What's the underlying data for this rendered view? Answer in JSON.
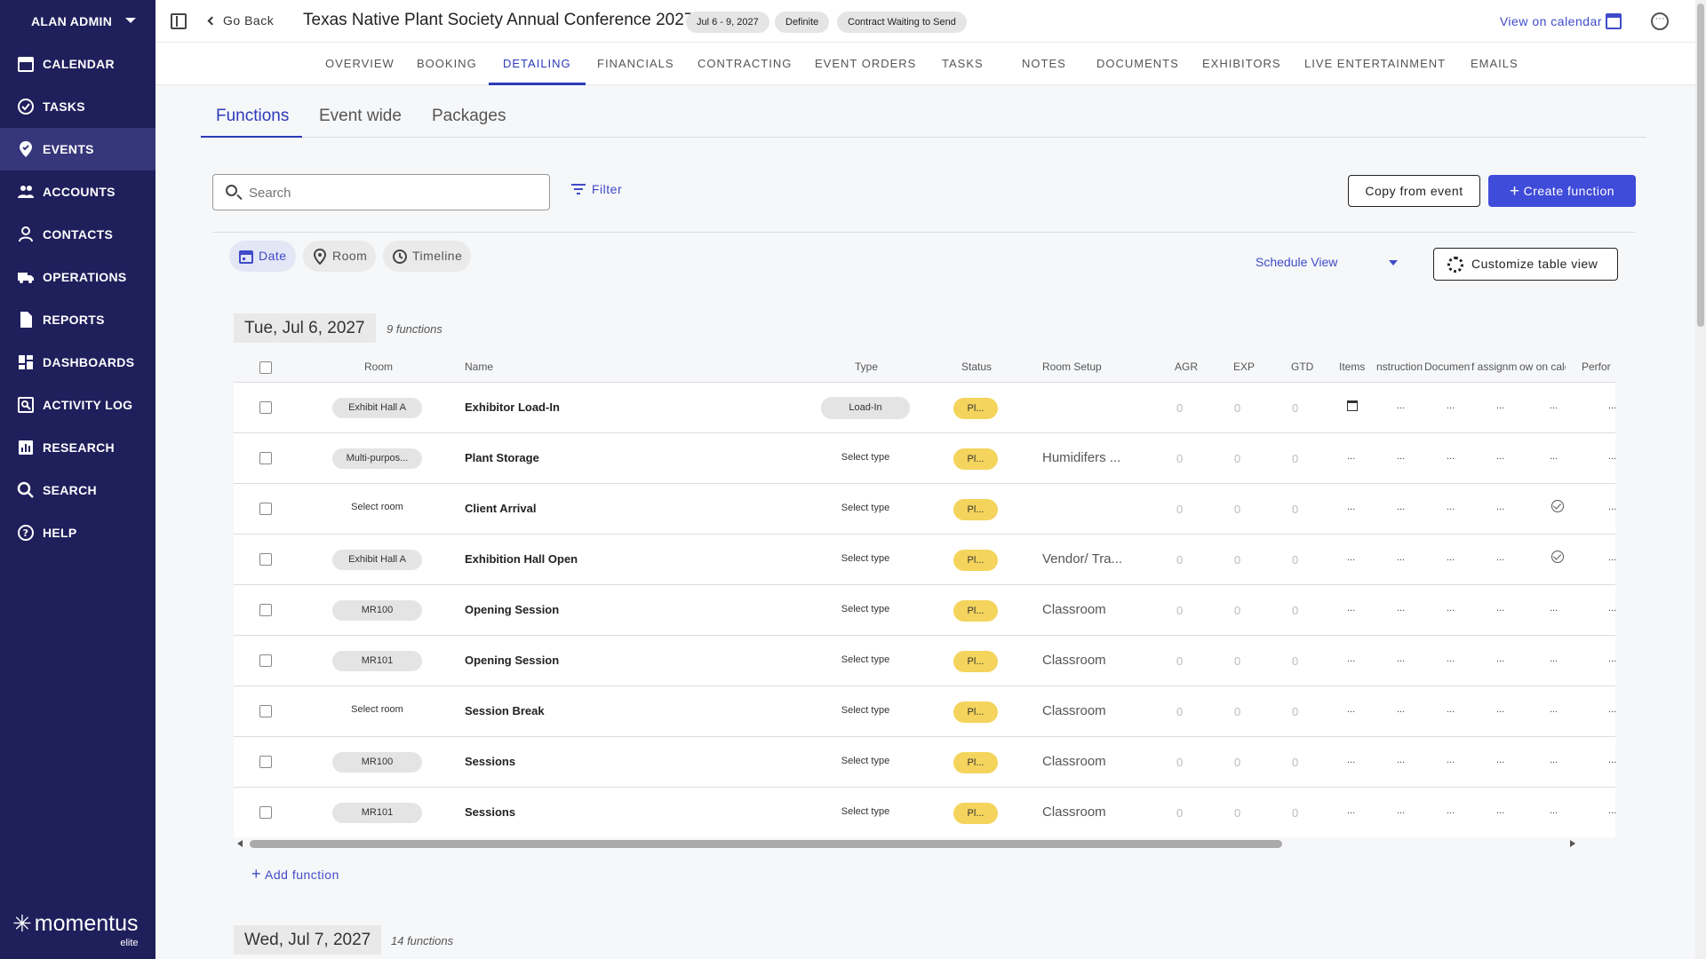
{
  "sidebar": {
    "user": "ALAN ADMIN",
    "items": [
      {
        "label": "CALENDAR",
        "icon": "calendar-icon"
      },
      {
        "label": "TASKS",
        "icon": "check-circle-icon"
      },
      {
        "label": "EVENTS",
        "icon": "pin-icon",
        "active": true
      },
      {
        "label": "ACCOUNTS",
        "icon": "people-icon"
      },
      {
        "label": "CONTACTS",
        "icon": "person-icon"
      },
      {
        "label": "OPERATIONS",
        "icon": "truck-icon"
      },
      {
        "label": "REPORTS",
        "icon": "document-icon"
      },
      {
        "label": "DASHBOARDS",
        "icon": "dashboard-icon"
      },
      {
        "label": "ACTIVITY LOG",
        "icon": "activity-log-icon"
      },
      {
        "label": "RESEARCH",
        "icon": "bar-chart-icon"
      },
      {
        "label": "SEARCH",
        "icon": "search-icon"
      },
      {
        "label": "HELP",
        "icon": "help-icon"
      }
    ],
    "logo": {
      "name": "momentus",
      "sub": "elite"
    }
  },
  "topbar": {
    "back_label": "Go Back",
    "event_title": "Texas Native Plant Society Annual Conference 2027",
    "date_range": "Jul 6 - 9, 2027",
    "status": "Definite",
    "contract_status": "Contract Waiting to Send",
    "view_calendar": "View on calendar"
  },
  "navtabs": [
    "OVERVIEW",
    "BOOKING",
    "DETAILING",
    "FINANCIALS",
    "CONTRACTING",
    "EVENT ORDERS",
    "TASKS",
    "NOTES",
    "DOCUMENTS",
    "EXHIBITORS",
    "LIVE ENTERTAINMENT",
    "EMAILS"
  ],
  "subtabs": [
    "Functions",
    "Event wide",
    "Packages"
  ],
  "toolbar": {
    "search_placeholder": "Search",
    "filter_label": "Filter",
    "copy_label": "Copy from event",
    "create_label": "Create function"
  },
  "views": {
    "chips": [
      "Date",
      "Room",
      "Timeline"
    ],
    "schedule_view": "Schedule View",
    "customize_label": "Customize table view"
  },
  "day1": {
    "label": "Tue, Jul 6, 2027",
    "count": "9 functions",
    "columns": [
      "Room",
      "Name",
      "Type",
      "Status",
      "Room Setup",
      "AGR",
      "EXP",
      "GTD",
      "Items",
      "nstruction",
      "Documents",
      "f assignm",
      "ow on caler",
      "Perfor"
    ],
    "rows": [
      {
        "room": "Exhibit Hall A",
        "room_chip": true,
        "name": "Exhibitor Load-In",
        "type": "Load-In",
        "type_chip": true,
        "status": "Pl...",
        "setup": "",
        "agr": "0",
        "exp": "0",
        "gtd": "0",
        "items_icon": true,
        "calendar_check": false
      },
      {
        "room": "Multi-purpos...",
        "room_chip": true,
        "name": "Plant Storage",
        "type": "Select type",
        "type_chip": false,
        "status": "Pl...",
        "setup": "Humidifers ...",
        "agr": "0",
        "exp": "0",
        "gtd": "0",
        "items_icon": false,
        "calendar_check": false
      },
      {
        "room": "Select room",
        "room_chip": false,
        "name": "Client Arrival",
        "type": "Select type",
        "type_chip": false,
        "status": "Pl...",
        "setup": "",
        "agr": "0",
        "exp": "0",
        "gtd": "0",
        "items_icon": false,
        "calendar_check": true
      },
      {
        "room": "Exhibit Hall A",
        "room_chip": true,
        "name": "Exhibition Hall Open",
        "type": "Select type",
        "type_chip": false,
        "status": "Pl...",
        "setup": "Vendor/ Tra...",
        "agr": "0",
        "exp": "0",
        "gtd": "0",
        "items_icon": false,
        "calendar_check": true
      },
      {
        "room": "MR100",
        "room_chip": true,
        "name": "Opening Session",
        "type": "Select type",
        "type_chip": false,
        "status": "Pl...",
        "setup": "Classroom",
        "agr": "0",
        "exp": "0",
        "gtd": "0",
        "items_icon": false,
        "calendar_check": false
      },
      {
        "room": "MR101",
        "room_chip": true,
        "name": "Opening Session",
        "type": "Select type",
        "type_chip": false,
        "status": "Pl...",
        "setup": "Classroom",
        "agr": "0",
        "exp": "0",
        "gtd": "0",
        "items_icon": false,
        "calendar_check": false
      },
      {
        "room": "Select room",
        "room_chip": false,
        "name": "Session Break",
        "type": "Select type",
        "type_chip": false,
        "status": "Pl...",
        "setup": "Classroom",
        "agr": "0",
        "exp": "0",
        "gtd": "0",
        "items_icon": false,
        "calendar_check": false
      },
      {
        "room": "MR100",
        "room_chip": true,
        "name": "Sessions",
        "type": "Select type",
        "type_chip": false,
        "status": "Pl...",
        "setup": "Classroom",
        "agr": "0",
        "exp": "0",
        "gtd": "0",
        "items_icon": false,
        "calendar_check": false
      },
      {
        "room": "MR101",
        "room_chip": true,
        "name": "Sessions",
        "type": "Select type",
        "type_chip": false,
        "status": "Pl...",
        "setup": "Classroom",
        "agr": "0",
        "exp": "0",
        "gtd": "0",
        "items_icon": false,
        "calendar_check": false
      }
    ],
    "ellipsis": "...",
    "add_label": "Add function"
  },
  "day2": {
    "label": "Wed, Jul 7, 2027",
    "count": "14 functions"
  },
  "colors": {
    "sidebar_bg": "#1f1f5c",
    "accent": "#3f4bd9",
    "status_planned": "#f4d45c"
  }
}
